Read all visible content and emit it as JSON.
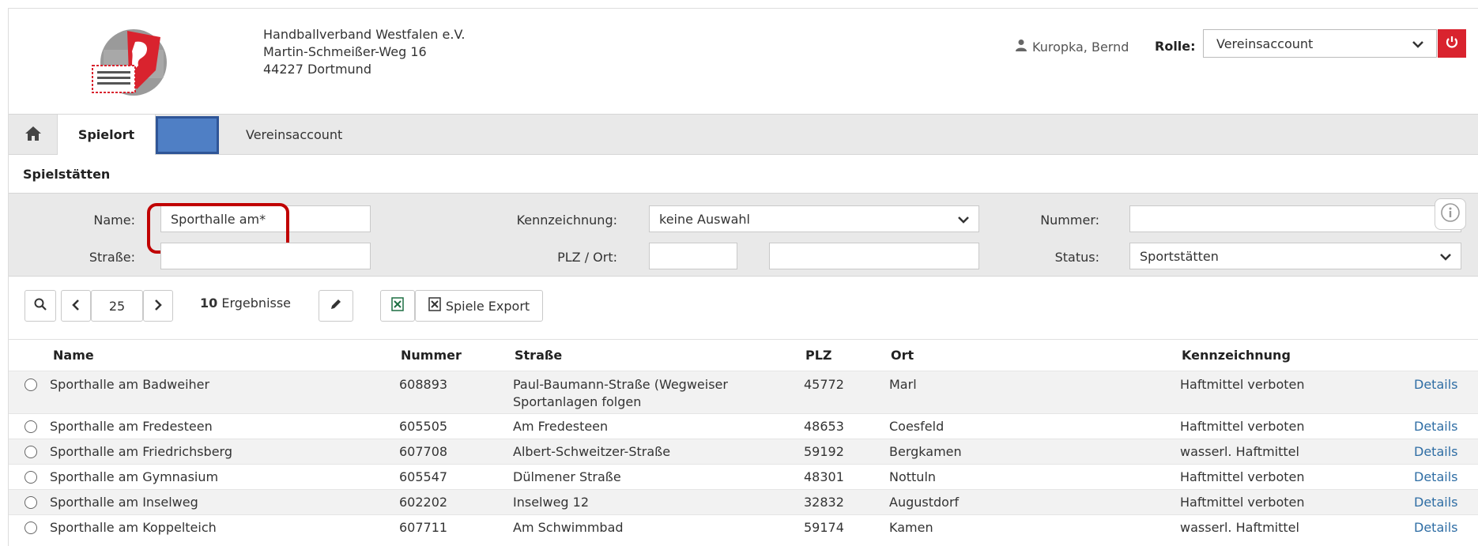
{
  "header": {
    "org_line1": "Handballverband Westfalen e.V.",
    "org_line2": "Martin-Schmeißer-Weg 16",
    "org_line3": "44227 Dortmund",
    "user_name": "Kuropka, Bernd",
    "rolle_label": "Rolle:",
    "rolle_value": "Vereinsaccount"
  },
  "tabs": {
    "active": "Spielort",
    "second": "Vereinsaccount"
  },
  "section_title": "Spielstätten",
  "filter": {
    "name_label": "Name:",
    "name_value": "Sporthalle am*",
    "strasse_label": "Straße:",
    "strasse_value": "",
    "kennzeichnung_label": "Kennzeichnung:",
    "kennzeichnung_value": "keine Auswahl",
    "plz_ort_label": "PLZ / Ort:",
    "plz_value": "",
    "ort_value": "",
    "nummer_label": "Nummer:",
    "nummer_value": "",
    "status_label": "Status:",
    "status_value": "Sportstätten"
  },
  "toolbar": {
    "page_size": "25",
    "result_count": "10",
    "result_label": "Ergebnisse",
    "export_label": "Spiele Export"
  },
  "table": {
    "headers": [
      "Name",
      "Nummer",
      "Straße",
      "PLZ",
      "Ort",
      "Kennzeichnung"
    ],
    "details_label": "Details",
    "rows": [
      {
        "name": "Sporthalle am Badweiher",
        "nummer": "608893",
        "strasse": "Paul-Baumann-Straße (Wegweiser",
        "strasse2": "Sportanlagen folgen",
        "plz": "45772",
        "ort": "Marl",
        "kennzeichnung": "Haftmittel verboten"
      },
      {
        "name": "Sporthalle am Fredesteen",
        "nummer": "605505",
        "strasse": "Am Fredesteen",
        "strasse2": "",
        "plz": "48653",
        "ort": "Coesfeld",
        "kennzeichnung": "Haftmittel verboten"
      },
      {
        "name": "Sporthalle am Friedrichsberg",
        "nummer": "607708",
        "strasse": "Albert-Schweitzer-Straße",
        "strasse2": "",
        "plz": "59192",
        "ort": "Bergkamen",
        "kennzeichnung": "wasserl. Haftmittel"
      },
      {
        "name": "Sporthalle am Gymnasium",
        "nummer": "605547",
        "strasse": "Dülmener Straße",
        "strasse2": "",
        "plz": "48301",
        "ort": "Nottuln",
        "kennzeichnung": "Haftmittel verboten"
      },
      {
        "name": "Sporthalle am Inselweg",
        "nummer": "602202",
        "strasse": "Inselweg 12",
        "strasse2": "",
        "plz": "32832",
        "ort": "Augustdorf",
        "kennzeichnung": "Haftmittel verboten"
      },
      {
        "name": "Sporthalle am Koppelteich",
        "nummer": "607711",
        "strasse": "Am Schwimmbad",
        "strasse2": "",
        "plz": "59174",
        "ort": "Kamen",
        "kennzeichnung": "wasserl. Haftmittel"
      }
    ]
  },
  "colors": {
    "accent_red": "#d9232e",
    "highlight_red": "#c00000",
    "tab_blue": "#4f7fc5",
    "link_blue": "#2e6da4",
    "panel_gray": "#e9e9e9"
  }
}
